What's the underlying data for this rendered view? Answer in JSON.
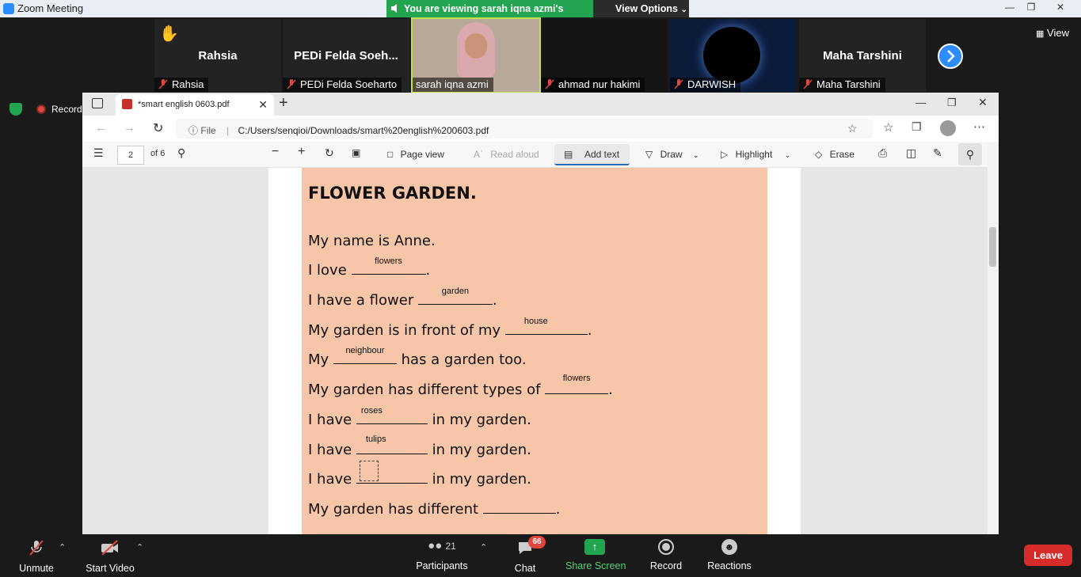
{
  "window": {
    "title": "Zoom Meeting"
  },
  "share_banner": {
    "text": "You are viewing sarah iqna azmi's screen",
    "view_options": "View Options"
  },
  "gallery": {
    "participants": [
      {
        "big": "Rahsia",
        "label": "Rahsia",
        "hand_raised": true
      },
      {
        "big": "PEDi Felda Soeh...",
        "label": "PEDi Felda Soeharto"
      },
      {
        "big": "",
        "label": "sarah iqna azmi",
        "active": true
      },
      {
        "big": "",
        "label": "ahmad nur hakimi"
      },
      {
        "big": "",
        "label": "DARWISH"
      },
      {
        "big": "Maha Tarshini",
        "label": "Maha Tarshini"
      }
    ],
    "view_label": "View"
  },
  "recording": {
    "label": "Recording"
  },
  "browser": {
    "tab_title": "*smart english 0603.pdf",
    "address_prefix": "File",
    "address": "C:/Users/senqioi/Downloads/smart%20english%200603.pdf"
  },
  "pdf_toolbar": {
    "page": "2",
    "page_of": "of 6",
    "page_view": "Page view",
    "read_aloud": "Read aloud",
    "add_text": "Add text",
    "draw": "Draw",
    "highlight": "Highlight",
    "erase": "Erase"
  },
  "worksheet": {
    "title": "FLOWER GARDEN.",
    "lines": [
      {
        "before": "My name is Anne.",
        "fill": null,
        "after": ""
      },
      {
        "before": "I love ",
        "fill": "flowers",
        "after": "."
      },
      {
        "before": "I have a flower ",
        "fill": "garden",
        "after": "."
      },
      {
        "before": "My garden is in front of my ",
        "fill": "house",
        "after": "."
      },
      {
        "before": "My ",
        "fill": "neighbour",
        "after": " has a garden too."
      },
      {
        "before": "My garden has different types of ",
        "fill": "flowers",
        "after": "."
      },
      {
        "before": "I have ",
        "fill": "roses",
        "after": " in my garden."
      },
      {
        "before": "I have ",
        "fill": "tulips",
        "after": " in my garden."
      },
      {
        "before": "I have ",
        "fill": "",
        "after": " in my garden."
      },
      {
        "before": "My garden has different ",
        "fill": "",
        "after": "."
      }
    ]
  },
  "bottom_bar": {
    "unmute": "Unmute",
    "start_video": "Start Video",
    "participants_count": "21",
    "participants": "Participants",
    "chat": "Chat",
    "chat_badge": "66",
    "share_screen": "Share Screen",
    "record": "Record",
    "reactions": "Reactions",
    "leave": "Leave"
  },
  "colors": {
    "zoom_blue": "#2d8cff",
    "share_green": "#23a450",
    "leave_red": "#d52b2b",
    "worksheet_bg": "#f7c6a8"
  }
}
